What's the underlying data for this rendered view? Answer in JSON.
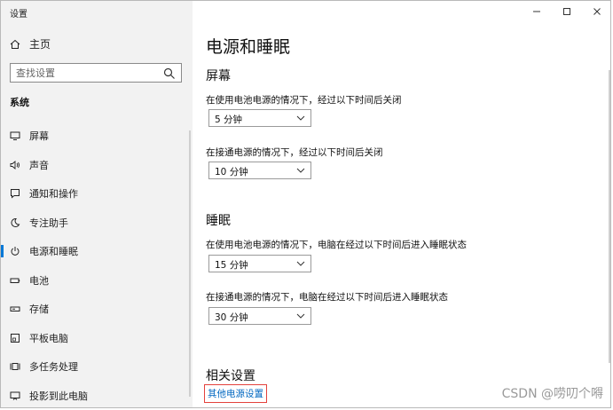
{
  "window": {
    "title": "设置"
  },
  "sidebar": {
    "home_label": "主页",
    "search_placeholder": "查找设置",
    "section_label": "系统",
    "items": [
      {
        "label": "屏幕",
        "icon": "display-icon",
        "active": false
      },
      {
        "label": "声音",
        "icon": "speaker-icon",
        "active": false
      },
      {
        "label": "通知和操作",
        "icon": "notification-icon",
        "active": false
      },
      {
        "label": "专注助手",
        "icon": "moon-icon",
        "active": false
      },
      {
        "label": "电源和睡眠",
        "icon": "power-icon",
        "active": true
      },
      {
        "label": "电池",
        "icon": "battery-icon",
        "active": false
      },
      {
        "label": "存储",
        "icon": "storage-icon",
        "active": false
      },
      {
        "label": "平板电脑",
        "icon": "tablet-icon",
        "active": false
      },
      {
        "label": "多任务处理",
        "icon": "multitask-icon",
        "active": false
      },
      {
        "label": "投影到此电脑",
        "icon": "project-icon",
        "active": false
      }
    ]
  },
  "main": {
    "title": "电源和睡眠",
    "screen": {
      "title": "屏幕",
      "battery_label": "在使用电池电源的情况下，经过以下时间后关闭",
      "battery_value": "5 分钟",
      "plugged_label": "在接通电源的情况下，经过以下时间后关闭",
      "plugged_value": "10 分钟"
    },
    "sleep": {
      "title": "睡眠",
      "battery_label": "在使用电池电源的情况下，电脑在经过以下时间后进入睡眠状态",
      "battery_value": "15 分钟",
      "plugged_label": "在接通电源的情况下，电脑在经过以下时间后进入睡眠状态",
      "plugged_value": "30 分钟"
    },
    "related": {
      "title": "相关设置",
      "link": "其他电源设置"
    }
  },
  "watermark": "CSDN @唠叨个嘚",
  "colors": {
    "accent": "#0078d7",
    "link": "#0067c0",
    "highlight_border": "#e4423c",
    "sidebar_bg": "#f2f2f2"
  }
}
